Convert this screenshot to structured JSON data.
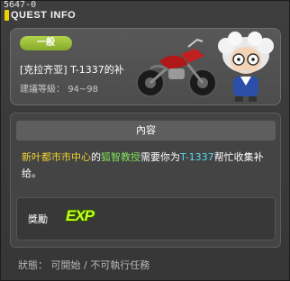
{
  "window": {
    "id": "5647-0",
    "title": "QUEST INFO"
  },
  "quest": {
    "category": "一般",
    "name": "[克拉齐亚] T-1337的补",
    "level_label": "建議等級：",
    "level_range": "94~98"
  },
  "content": {
    "header": "內容",
    "desc": {
      "location": "新叶都市市中心",
      "of": "的",
      "npc": "狐智教授",
      "middle": "需要你为",
      "target": "T-1337",
      "rest": "帮忙收集补给。"
    },
    "reward": {
      "label": "獎勵",
      "icon": "exp-icon",
      "icon_text": "EXP"
    }
  },
  "status": {
    "text": "狀態： 可開始 / 不可執行任務"
  },
  "colors": {
    "location": "#f1d433",
    "npc": "#7fe25b",
    "target": "#58d8f0",
    "badge": "#9ec13a"
  }
}
